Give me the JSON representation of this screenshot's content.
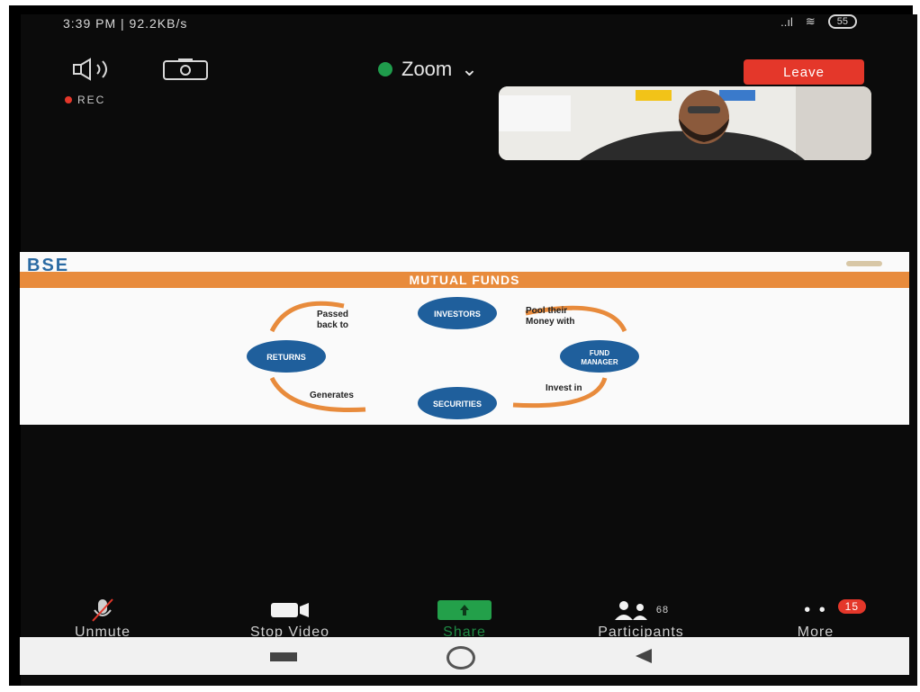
{
  "status": {
    "time_speed": "3:39 PM | 92.2KB/s",
    "signal": "..ıl",
    "wifi": "≋",
    "battery": "55"
  },
  "header": {
    "app_title": "Zoom",
    "leave_label": "Leave",
    "rec_label": "REC"
  },
  "slide": {
    "logo": "BSE",
    "title": "MUTUAL FUNDS",
    "nodes": [
      "INVESTORS",
      "FUND MANAGER",
      "SECURITIES",
      "RETURNS"
    ],
    "arrow_labels": {
      "pool": [
        "Pool their",
        "Money with"
      ],
      "invest": "Invest in",
      "generates": "Generates",
      "passed": [
        "Passed",
        "back to"
      ]
    }
  },
  "controls": {
    "unmute": "Unmute",
    "stop_video": "Stop Video",
    "share": "Share",
    "participants": "Participants",
    "participants_count": "68",
    "more": "More",
    "more_badge": "15"
  },
  "colors": {
    "leave": "#e4372a",
    "share": "#23a04a",
    "slide_banner": "#e88b3c",
    "node_fill": "#1f5f9c"
  }
}
